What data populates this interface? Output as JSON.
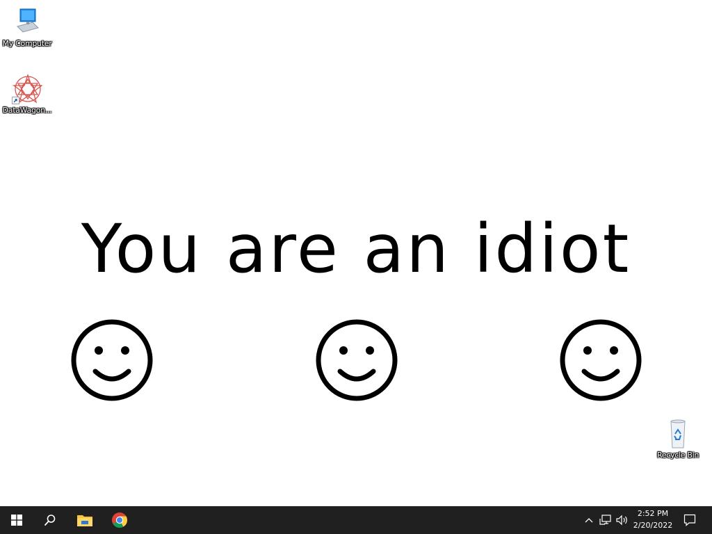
{
  "desktop": {
    "icons": [
      {
        "label": "My Computer",
        "icon": "monitor-icon"
      },
      {
        "label": "DataWagon...",
        "icon": "datawagon-icon"
      },
      {
        "label": "Recycle Bin",
        "icon": "recycle-bin-icon"
      }
    ]
  },
  "popup": {
    "message": "You are an idiot",
    "smileys": [
      "smiley-face-icon",
      "smiley-face-icon",
      "smiley-face-icon"
    ]
  },
  "taskbar": {
    "start_icon": "windows-logo-icon",
    "search_icon": "search-icon",
    "pinned": [
      {
        "icon": "file-explorer-icon"
      },
      {
        "icon": "chrome-icon"
      }
    ],
    "tray": {
      "chevron_icon": "chevron-up-icon",
      "network_icon": "network-icon",
      "volume_icon": "volume-icon",
      "time": "2:52 PM",
      "date": "2/20/2022",
      "notification_icon": "notification-icon"
    },
    "colors": {
      "background": "#202020",
      "accent": "#1a73e8"
    }
  }
}
